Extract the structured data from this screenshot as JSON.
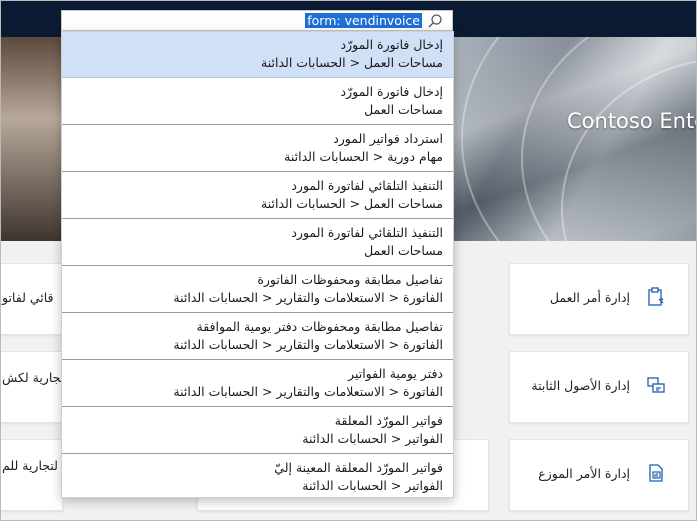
{
  "search": {
    "query": "form: vendinvoice"
  },
  "hero": {
    "title": "Contoso Ente"
  },
  "tiles": {
    "work_order_management": "إدارة أمر العمل",
    "fixed_assets_management": "إدارة الأصول الثابتة",
    "distributed_order_management": "إدارة الأمر الموزع",
    "left_row1": "قائي لفاتو",
    "left_row2": "لتجارية لكش",
    "left_row3": "لتجارية للم"
  },
  "results": [
    {
      "title": "إدخال فاتورة المورّد",
      "path": "مساحات العمل < الحسابات الدائنة"
    },
    {
      "title": "إدخال فاتورة المورّد",
      "path": "مساحات العمل"
    },
    {
      "title": "استرداد فواتير المورد",
      "path": "مهام دورية < الحسابات الدائنة"
    },
    {
      "title": "التنفيذ التلقائي لفاتورة المورد",
      "path": "مساحات العمل < الحسابات الدائنة"
    },
    {
      "title": "التنفيذ التلقائي لفاتورة المورد",
      "path": "مساحات العمل"
    },
    {
      "title": "تفاصيل مطابقة ومحفوظات الفاتورة",
      "path": "الفاتورة < الاستعلامات والتقارير < الحسابات الدائنة"
    },
    {
      "title": "تفاصيل مطابقة ومحفوظات دفتر يومية الموافقة",
      "path": "الفاتورة < الاستعلامات والتقارير < الحسابات الدائنة"
    },
    {
      "title": "دفتر يومية الفواتير",
      "path": "الفاتورة < الاستعلامات والتقارير < الحسابات الدائنة"
    },
    {
      "title": "فواتير المورّد المعلقة",
      "path": "الفواتير < الحسابات الدائنة"
    },
    {
      "title": "فواتير المورّد المعلقة المعينة إليّ",
      "path": "الفواتير < الحسابات الدائنة"
    }
  ],
  "colors": {
    "navbar": "#0b1a33",
    "selection": "#cfe0f7",
    "query_highlight": "#1e6fd6",
    "icon_blue": "#1e5fb4"
  }
}
